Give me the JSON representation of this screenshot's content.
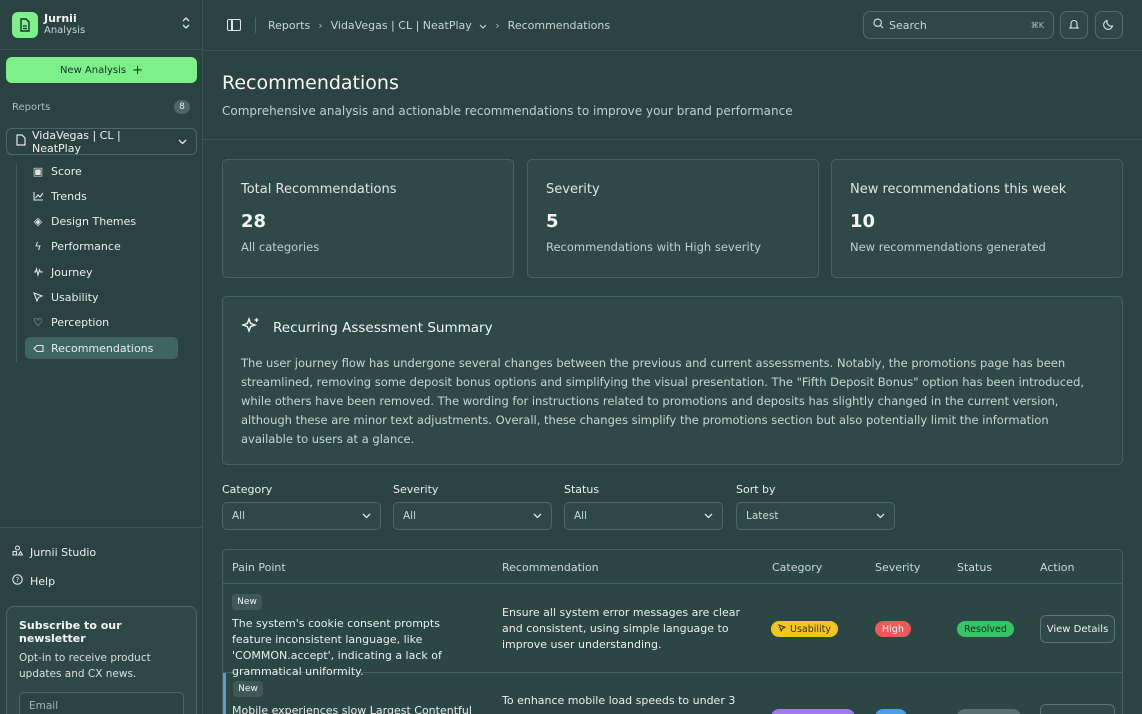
{
  "brand": {
    "name": "Jurnii",
    "sub": "Analysis"
  },
  "sidebar": {
    "new_analysis": "New Analysis",
    "reports_label": "Reports",
    "reports_count": "8",
    "report_select": "VidaVegas | CL | NeatPlay",
    "items": [
      {
        "label": "Score",
        "icon": "score-icon"
      },
      {
        "label": "Trends",
        "icon": "trends-icon"
      },
      {
        "label": "Design Themes",
        "icon": "design-themes-icon"
      },
      {
        "label": "Performance",
        "icon": "performance-icon"
      },
      {
        "label": "Journey",
        "icon": "journey-icon"
      },
      {
        "label": "Usability",
        "icon": "usability-icon"
      },
      {
        "label": "Perception",
        "icon": "perception-icon"
      },
      {
        "label": "Recommendations",
        "icon": "recommendations-icon",
        "active": true
      }
    ],
    "studio": "Jurnii Studio",
    "help": "Help",
    "newsletter": {
      "title": "Subscribe to our newsletter",
      "text": "Opt-in to receive product updates and CX news.",
      "email_placeholder": "Email"
    }
  },
  "topbar": {
    "breadcrumb": [
      "Reports",
      "VidaVegas | CL | NeatPlay",
      "Recommendations"
    ],
    "search_placeholder": "Search",
    "search_shortcut": "⌘K"
  },
  "page": {
    "title": "Recommendations",
    "subtitle": "Comprehensive analysis and actionable recommendations to improve your brand performance"
  },
  "stats": [
    {
      "label": "Total Recommendations",
      "value": "28",
      "note": "All categories"
    },
    {
      "label": "Severity",
      "value": "5",
      "note": "Recommendations with High severity"
    },
    {
      "label": "New recommendations this week",
      "value": "10",
      "note": "New recommendations generated"
    }
  ],
  "summary": {
    "title": "Recurring Assessment Summary",
    "body": "The user journey flow has undergone several changes between the previous and current assessments. Notably, the promotions page has been streamlined, removing some deposit bonus options and simplifying the visual presentation. The \"Fifth Deposit Bonus\" option has been introduced, while others have been removed. The wording for instructions related to promotions and deposits has slightly changed in the current version, although these are minor text adjustments. Overall, these changes simplify the promotions section but also potentially limit the information available to users at a glance."
  },
  "filters": [
    {
      "label": "Category",
      "value": "All"
    },
    {
      "label": "Severity",
      "value": "All"
    },
    {
      "label": "Status",
      "value": "All"
    },
    {
      "label": "Sort by",
      "value": "Latest"
    }
  ],
  "table": {
    "headers": [
      "Pain Point",
      "Recommendation",
      "Category",
      "Severity",
      "Status",
      "Action"
    ],
    "rows": [
      {
        "tag": "New",
        "pain_point": "The system's cookie consent prompts feature inconsistent language, like 'COMMON.accept', indicating a lack of grammatical uniformity.",
        "recommendation": "Ensure all system error messages are clear and consistent, using simple language to improve user understanding.",
        "category": "Usability",
        "severity": "High",
        "status": "Resolved",
        "action": "View Details"
      },
      {
        "tag": "New",
        "pain_point": "Mobile experiences slow Largest Contentful Paint",
        "recommendation": "To enhance mobile load speeds to under 3",
        "category": "",
        "severity": "",
        "status": "",
        "action": ""
      }
    ]
  },
  "colors": {
    "accent": "#7ef08a",
    "background": "#2b4442",
    "usability": "#f3c61f",
    "high": "#e95b5b",
    "resolved": "#35c467"
  }
}
